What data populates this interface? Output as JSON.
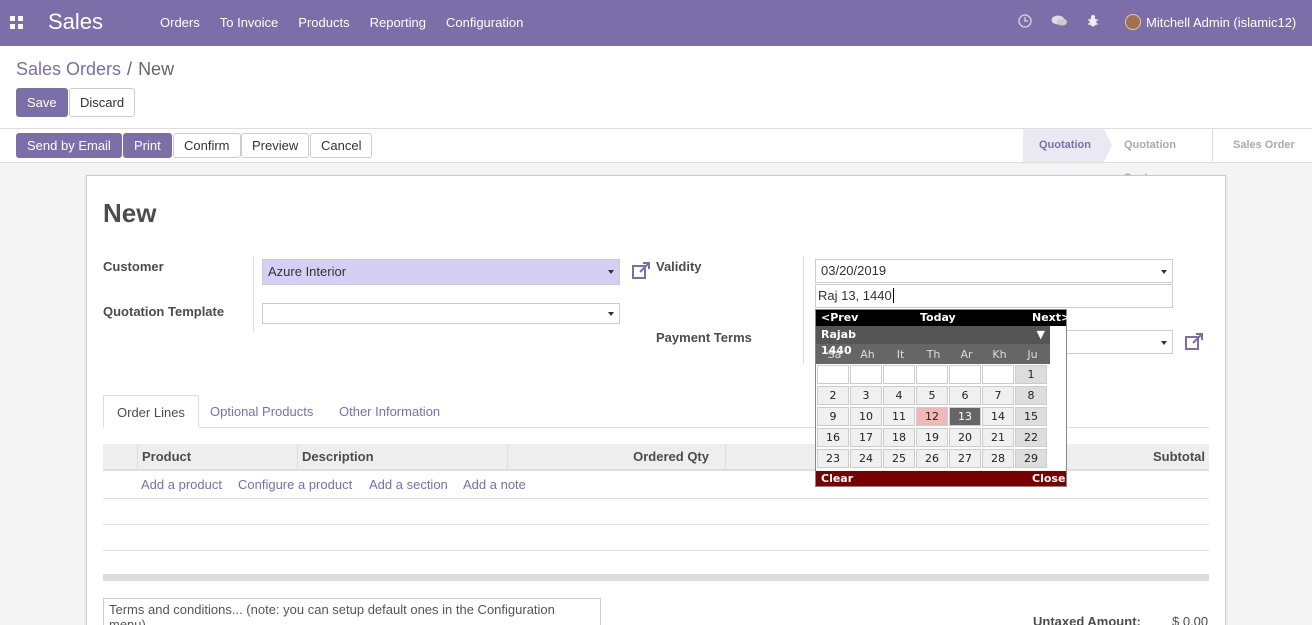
{
  "topbar": {
    "brand": "Sales",
    "menu": [
      "Orders",
      "To Invoice",
      "Products",
      "Reporting",
      "Configuration"
    ],
    "icons": [
      "clock-icon",
      "chat-icon",
      "bug-icon"
    ],
    "user": "Mitchell Admin (islamic12)"
  },
  "breadcrumb": {
    "parent": "Sales Orders",
    "separator": "/",
    "current": "New"
  },
  "buttons": {
    "save": "Save",
    "discard": "Discard"
  },
  "actions": {
    "send_email": "Send by Email",
    "print": "Print",
    "confirm": "Confirm",
    "preview": "Preview",
    "cancel": "Cancel"
  },
  "stages": [
    "Quotation",
    "Quotation Sent",
    "Sales Order"
  ],
  "form": {
    "title": "New",
    "customer_label": "Customer",
    "customer_value": "Azure Interior",
    "template_label": "Quotation Template",
    "template_value": "",
    "validity_label": "Validity",
    "validity_value": "03/20/2019",
    "hijri_value": "Raj 13, 1440",
    "payment_terms_label": "Payment Terms"
  },
  "tabs": [
    "Order Lines",
    "Optional Products",
    "Other Information"
  ],
  "table": {
    "headers": [
      "Product",
      "Description",
      "Ordered Qty",
      "Subtotal"
    ],
    "add_links": [
      "Add a product",
      "Configure a product",
      "Add a section",
      "Add a note"
    ]
  },
  "terms_placeholder": "Terms and conditions... (note: you can setup default ones in the Configuration menu)",
  "totals": {
    "untaxed_label": "Untaxed Amount:",
    "untaxed_value": "$ 0.00"
  },
  "datepicker": {
    "prev": "<Prev",
    "today": "Today",
    "next": "Next>",
    "month": "Rajab",
    "year": "1440",
    "weekdays": [
      "Sa",
      "Ah",
      "It",
      "Th",
      "Ar",
      "Kh",
      "Ju"
    ],
    "weeks": [
      [
        "",
        "",
        "",
        "",
        "",
        "",
        "1"
      ],
      [
        "2",
        "3",
        "4",
        "5",
        "6",
        "7",
        "8"
      ],
      [
        "9",
        "10",
        "11",
        "12",
        "13",
        "14",
        "15"
      ],
      [
        "16",
        "17",
        "18",
        "19",
        "20",
        "21",
        "22"
      ],
      [
        "23",
        "24",
        "25",
        "26",
        "27",
        "28",
        "29"
      ]
    ],
    "today_day": "12",
    "selected_day": "13",
    "clear": "Clear",
    "close": "Close"
  },
  "colors": {
    "brand": "#7c6ea8",
    "selected_field": "#d6cff5"
  }
}
